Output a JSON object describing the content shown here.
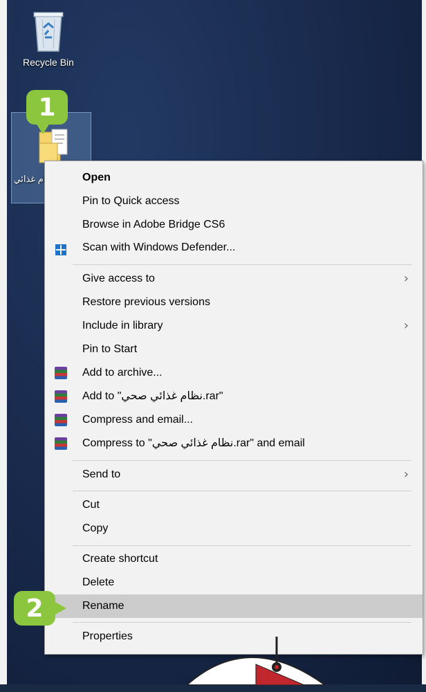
{
  "desktop": {
    "recycle_bin": {
      "label": "Recycle Bin",
      "icon": "recycle-bin-icon"
    },
    "folder": {
      "label": "نظام غذائي صحي",
      "icon": "folder-icon"
    }
  },
  "badges": {
    "step1": "1",
    "step2": "2"
  },
  "colors": {
    "badge": "#8cc63f",
    "menu_bg": "#f2f2f2",
    "hover": "#cccccc"
  },
  "context_menu": {
    "open": "Open",
    "pin_quick_access": "Pin to Quick access",
    "browse_bridge": "Browse in Adobe Bridge CS6",
    "scan_defender": "Scan with Windows Defender...",
    "give_access": "Give access to",
    "restore_versions": "Restore previous versions",
    "include_library": "Include in library",
    "pin_start": "Pin to Start",
    "add_archive": "Add to archive...",
    "add_to_rar": "Add to \"نظام غذائي صحي.rar\"",
    "compress_email": "Compress and email...",
    "compress_to_rar_email": "Compress to \"نظام غذائي صحي.rar\" and email",
    "send_to": "Send to",
    "cut": "Cut",
    "copy": "Copy",
    "create_shortcut": "Create shortcut",
    "delete": "Delete",
    "rename": "Rename",
    "properties": "Properties"
  }
}
